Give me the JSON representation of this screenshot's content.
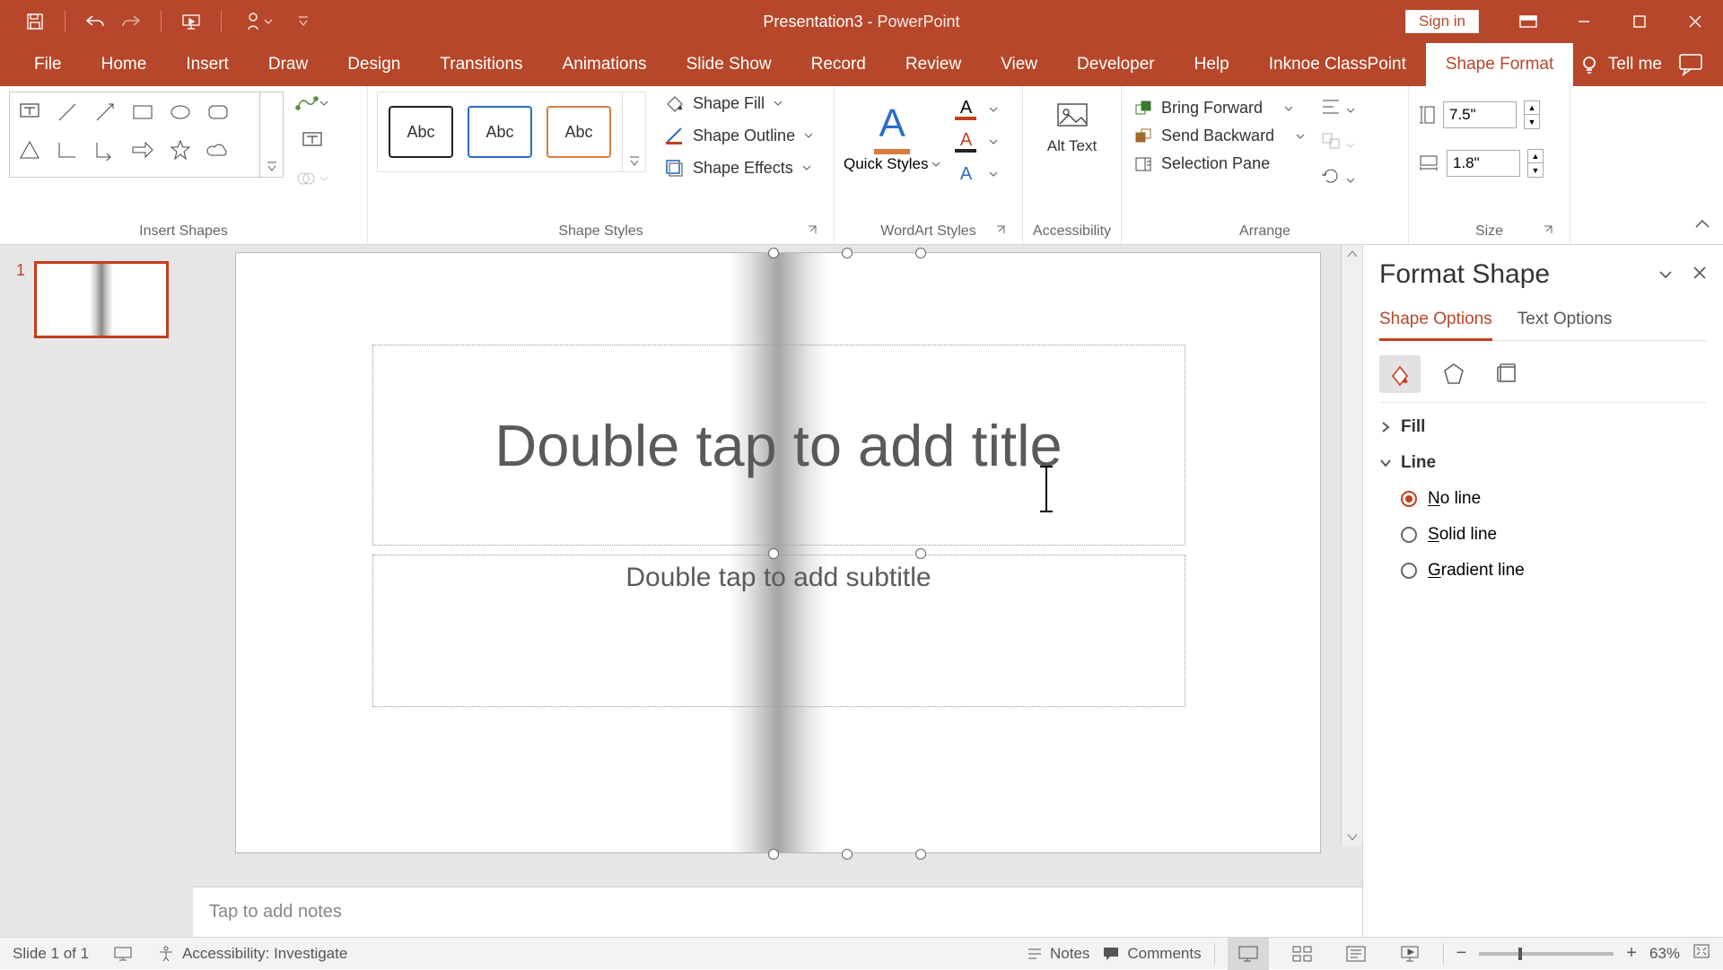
{
  "title": {
    "doc": "Presentation3",
    "sep": "  -  ",
    "app": "PowerPoint"
  },
  "signin": "Sign in",
  "tabs": [
    "File",
    "Home",
    "Insert",
    "Draw",
    "Design",
    "Transitions",
    "Animations",
    "Slide Show",
    "Record",
    "Review",
    "View",
    "Developer",
    "Help",
    "Inknoe ClassPoint"
  ],
  "contextual_tab": "Shape Format",
  "tellme": "Tell me",
  "ribbon": {
    "insert_shapes": "Insert Shapes",
    "shape_styles": "Shape Styles",
    "wordart_styles": "WordArt Styles",
    "accessibility": "Accessibility",
    "arrange": "Arrange",
    "size": "Size",
    "style_swatch": "Abc",
    "shape_fill": "Shape Fill",
    "shape_outline": "Shape Outline",
    "shape_effects": "Shape Effects",
    "quick_styles": "Quick Styles",
    "alt_text": "Alt Text",
    "bring_forward": "Bring Forward",
    "send_backward": "Send Backward",
    "selection_pane": "Selection Pane",
    "size_h": "7.5\"",
    "size_w": "1.8\""
  },
  "thumbs": {
    "n1": "1"
  },
  "placeholders": {
    "title": "Double tap to add title",
    "subtitle": "Double tap to add subtitle"
  },
  "notes_placeholder": "Tap to add notes",
  "format_pane": {
    "title": "Format Shape",
    "tab_shape": "Shape Options",
    "tab_text": "Text Options",
    "section_fill": "Fill",
    "section_line": "Line",
    "opt_none": "No line",
    "opt_solid": "Solid line",
    "opt_gradient": "Gradient line"
  },
  "status": {
    "slide": "Slide 1 of 1",
    "accessibility": "Accessibility: Investigate",
    "notes": "Notes",
    "comments": "Comments",
    "zoom": "63%"
  }
}
